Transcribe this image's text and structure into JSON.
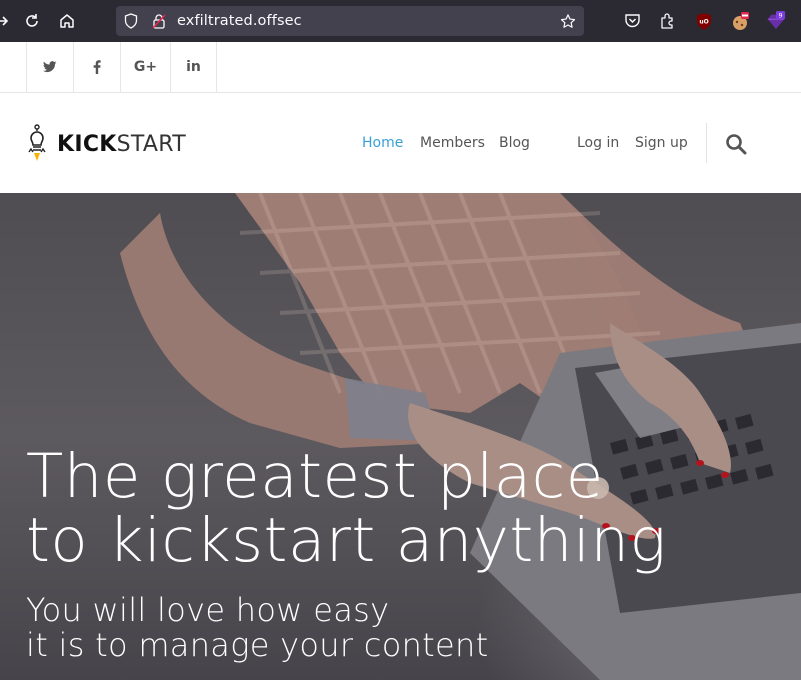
{
  "browser": {
    "url": "exfiltrated.offsec",
    "extension_badge": "9"
  },
  "social": {
    "items": [
      {
        "name": "twitter",
        "glyph": "𝕥"
      },
      {
        "name": "facebook",
        "glyph": "f"
      },
      {
        "name": "google-plus",
        "glyph": "G+"
      },
      {
        "name": "linkedin",
        "glyph": "in"
      }
    ]
  },
  "header": {
    "logo_bold": "KICK",
    "logo_light": "START",
    "nav": {
      "home": "Home",
      "members": "Members",
      "blog": "Blog",
      "login": "Log in",
      "signup": "Sign up"
    }
  },
  "hero": {
    "title_line1": "The greatest place",
    "title_line2": "to kickstart anything",
    "subtitle_line1": "You will love how easy",
    "subtitle_line2": "it is to manage your content"
  },
  "colors": {
    "nav_active": "#3aa0d8",
    "chrome_bg": "#2b2a33",
    "urlbar_bg": "#42414d"
  }
}
